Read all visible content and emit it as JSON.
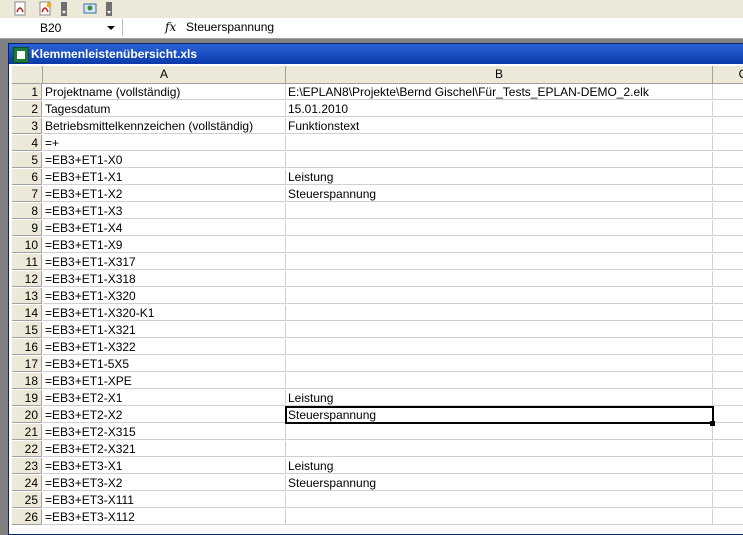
{
  "formula_bar": {
    "name_box": "B20",
    "fx_label": "fx",
    "content": "Steuerspannung"
  },
  "window": {
    "title": "Klemmenleistenübersicht.xls"
  },
  "sheet": {
    "columns": [
      "A",
      "B",
      "C"
    ],
    "rows": [
      {
        "n": "1",
        "a": "Projektname (vollständig)",
        "b": "E:\\EPLAN8\\Projekte\\Bernd Gischel\\Für_Tests_EPLAN-DEMO_2.elk"
      },
      {
        "n": "2",
        "a": "Tagesdatum",
        "b": "15.01.2010"
      },
      {
        "n": "3",
        "a": "Betriebsmittelkennzeichen (vollständig)",
        "b": "Funktionstext"
      },
      {
        "n": "4",
        "a": "=+",
        "b": ""
      },
      {
        "n": "5",
        "a": "=EB3+ET1-X0",
        "b": ""
      },
      {
        "n": "6",
        "a": "=EB3+ET1-X1",
        "b": "Leistung"
      },
      {
        "n": "7",
        "a": "=EB3+ET1-X2",
        "b": "Steuerspannung"
      },
      {
        "n": "8",
        "a": "=EB3+ET1-X3",
        "b": ""
      },
      {
        "n": "9",
        "a": "=EB3+ET1-X4",
        "b": ""
      },
      {
        "n": "10",
        "a": "=EB3+ET1-X9",
        "b": ""
      },
      {
        "n": "11",
        "a": "=EB3+ET1-X317",
        "b": ""
      },
      {
        "n": "12",
        "a": "=EB3+ET1-X318",
        "b": ""
      },
      {
        "n": "13",
        "a": "=EB3+ET1-X320",
        "b": ""
      },
      {
        "n": "14",
        "a": "=EB3+ET1-X320-K1",
        "b": ""
      },
      {
        "n": "15",
        "a": "=EB3+ET1-X321",
        "b": ""
      },
      {
        "n": "16",
        "a": "=EB3+ET1-X322",
        "b": ""
      },
      {
        "n": "17",
        "a": "=EB3+ET1-5X5",
        "b": ""
      },
      {
        "n": "18",
        "a": "=EB3+ET1-XPE",
        "b": ""
      },
      {
        "n": "19",
        "a": "=EB3+ET2-X1",
        "b": "Leistung"
      },
      {
        "n": "20",
        "a": "=EB3+ET2-X2",
        "b": "Steuerspannung"
      },
      {
        "n": "21",
        "a": "=EB3+ET2-X315",
        "b": ""
      },
      {
        "n": "22",
        "a": "=EB3+ET2-X321",
        "b": ""
      },
      {
        "n": "23",
        "a": "=EB3+ET3-X1",
        "b": "Leistung"
      },
      {
        "n": "24",
        "a": "=EB3+ET3-X2",
        "b": "Steuerspannung"
      },
      {
        "n": "25",
        "a": "=EB3+ET3-X111",
        "b": ""
      },
      {
        "n": "26",
        "a": "=EB3+ET3-X112",
        "b": ""
      }
    ]
  },
  "icons": {
    "pdf": "pdf-icon",
    "pdf_settings": "pdf-settings-icon",
    "addin": "addin-icon"
  },
  "colors": {
    "titlebar": "#0b3aa8",
    "header_bg": "#ece9d8"
  }
}
